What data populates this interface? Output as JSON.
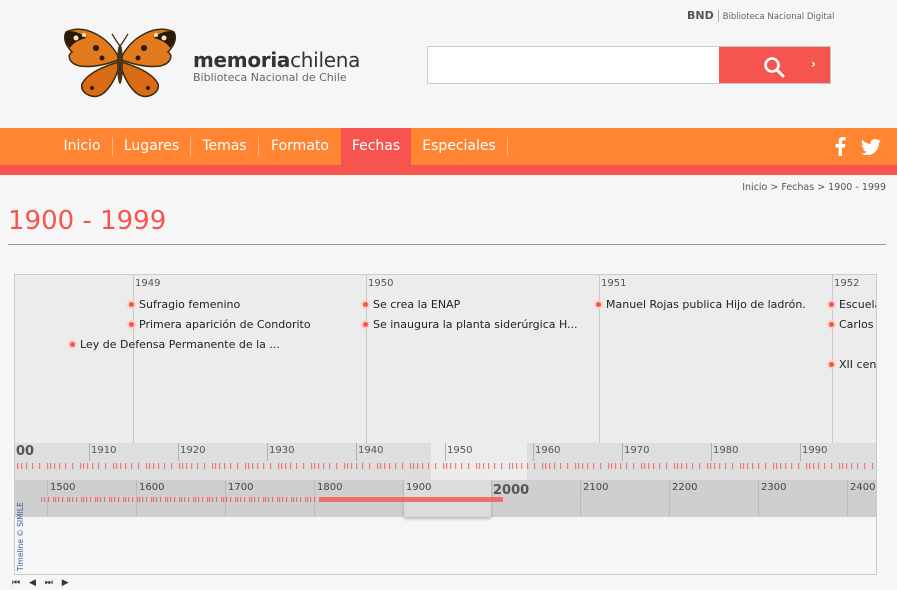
{
  "header": {
    "bnd_short": "BND",
    "bnd_full": "Biblioteca Nacional Digital",
    "brand_part1": "memoria",
    "brand_part2": "chilena",
    "brand_sub": "Biblioteca Nacional de Chile",
    "logo_icon": "butterfly-logo"
  },
  "search": {
    "value": "",
    "placeholder": "",
    "button_icon": "search-icon",
    "arrow": "›"
  },
  "nav": {
    "items": [
      "Inicio",
      "Lugares",
      "Temas",
      "Formato",
      "Fechas",
      "Especiales"
    ],
    "active": "Fechas",
    "social": [
      "facebook-icon",
      "twitter-icon"
    ]
  },
  "breadcrumb": "Inicio > Fechas > 1900 - 1999",
  "page_title": "1900 - 1999",
  "timeline": {
    "years": [
      "1949",
      "1950",
      "1951",
      "1952"
    ],
    "events": [
      "Sufragio femenino",
      "Primera aparición de Condorito",
      "Ley de Defensa Permanente de la ...",
      "Se crea la ENAP",
      "Se inaugura la planta siderúrgica H...",
      "Manuel Rojas publica Hijo de ladrón.",
      "Escuela",
      "Carlos",
      "XII cens"
    ],
    "decades": [
      "00",
      "1910",
      "1920",
      "1930",
      "1940",
      "1950",
      "1960",
      "1970",
      "1980",
      "1990"
    ],
    "centuries": [
      "1500",
      "1600",
      "1700",
      "1800",
      "1900",
      "2000",
      "2100",
      "2200",
      "2300",
      "2400"
    ],
    "credit": "Timeline © SIMILE",
    "controls": [
      "⏮",
      "◀",
      "⏭",
      "▶"
    ]
  },
  "colors": {
    "accent": "#f6554f",
    "nav": "#ff8533"
  }
}
